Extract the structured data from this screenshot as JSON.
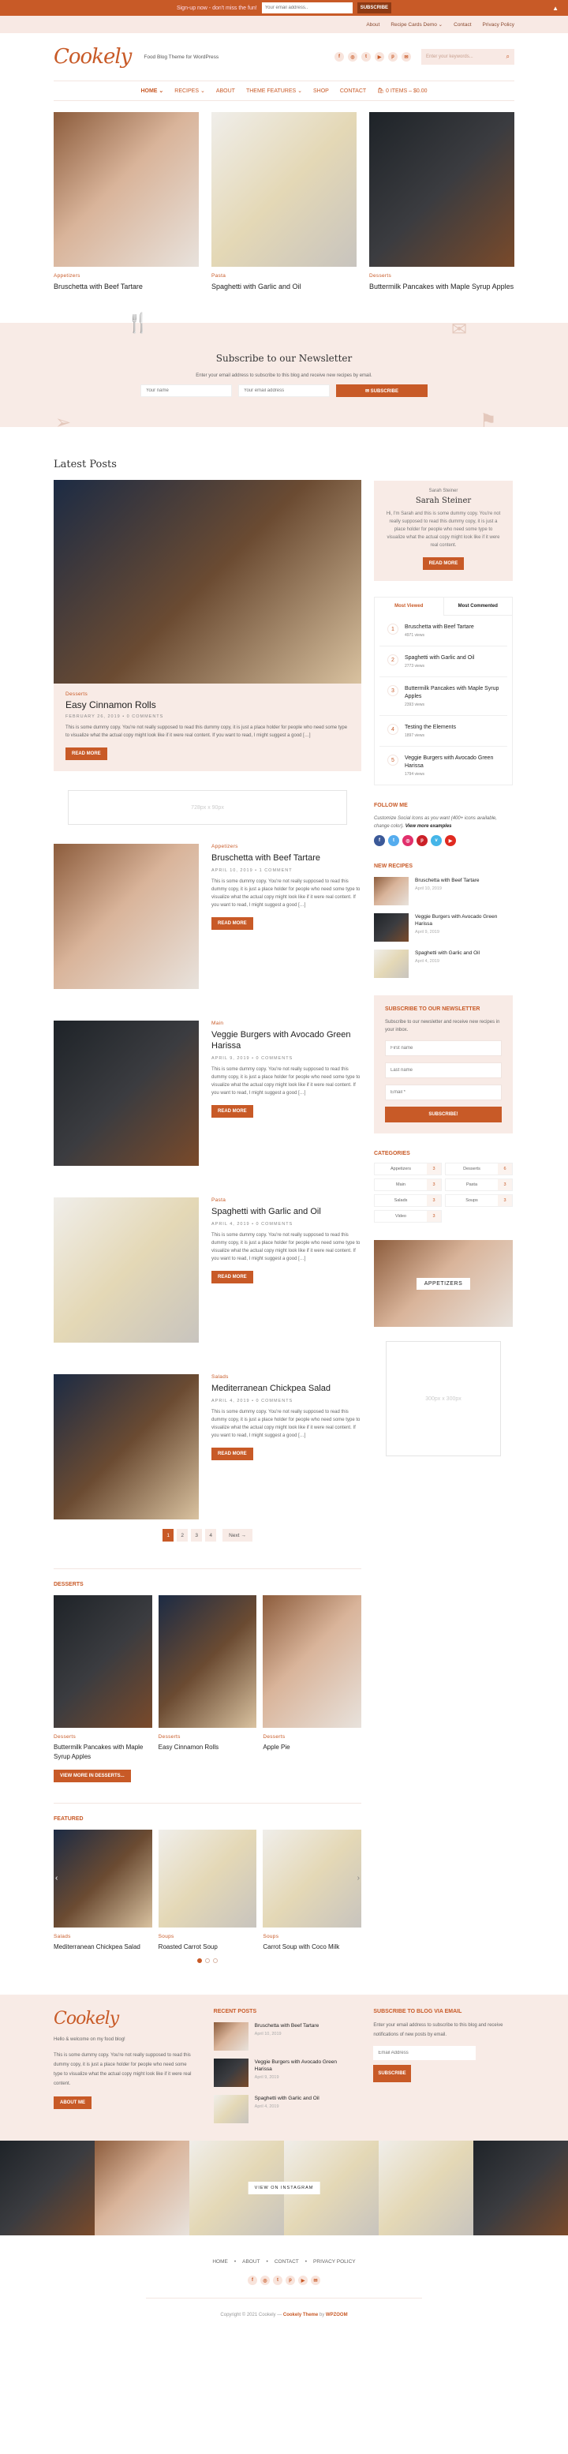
{
  "topbar": {
    "text": "Sign-up now - don't miss the fun!",
    "email_placeholder": "Your email address..",
    "button": "SUBSCRIBE"
  },
  "subnav": [
    "About",
    "Recipe Cards Demo ⌄",
    "Contact",
    "Privacy Policy"
  ],
  "header": {
    "logo": "Cookely",
    "tagline": "Food Blog Theme for WordPress",
    "search_placeholder": "Enter your keywords...",
    "social": [
      "f",
      "◎",
      "t",
      "▶",
      "p",
      "✉"
    ]
  },
  "nav": [
    {
      "label": "Home ⌄",
      "active": true
    },
    {
      "label": "Recipes ⌄"
    },
    {
      "label": "About"
    },
    {
      "label": "Theme Features ⌄"
    },
    {
      "label": "Shop"
    },
    {
      "label": "Contact"
    },
    {
      "label": "🛍 0 items – $0.00"
    }
  ],
  "hero": [
    {
      "category": "Appetizers",
      "title": "Bruschetta with Beef Tartare"
    },
    {
      "category": "Pasta",
      "title": "Spaghetti with Garlic and Oil"
    },
    {
      "category": "Desserts",
      "title": "Buttermilk Pancakes with Maple Syrup Apples"
    }
  ],
  "newsletter": {
    "title": "Subscribe to our Newsletter",
    "text": "Enter your email address to subscribe to this blog and receive new recipes by email.",
    "name_placeholder": "Your name",
    "email_placeholder": "Your email address",
    "button": "✉  SUBSCRIBE"
  },
  "latest": {
    "title": "Latest Posts",
    "featured": {
      "category": "Desserts",
      "title": "Easy Cinnamon Rolls",
      "meta": "February 26, 2019 • 0 Comments",
      "excerpt": "This is some dummy copy. You're not really supposed to read this dummy copy, it is just a place holder for people who need some type to visualize what the actual copy might look like if it were real content. If you want to read, I might suggest a good […]",
      "button": "Read More"
    },
    "ad": "728px x 90px",
    "posts": [
      {
        "category": "Appetizers",
        "title": "Bruschetta with Beef Tartare",
        "meta": "April 10, 2019 • 1 Comment",
        "excerpt": "This is some dummy copy. You're not really supposed to read this dummy copy, it is just a place holder for people who need some type to visualize what the actual copy might look like if it were real content. If you want to read, I might suggest a good […]",
        "button": "Read More"
      },
      {
        "category": "Main",
        "title": "Veggie Burgers with Avocado Green Harissa",
        "meta": "April 9, 2019 • 0 Comments",
        "excerpt": "This is some dummy copy. You're not really supposed to read this dummy copy, it is just a place holder for people who need some type to visualize what the actual copy might look like if it were real content. If you want to read, I might suggest a good […]",
        "button": "Read More"
      },
      {
        "category": "Pasta",
        "title": "Spaghetti with Garlic and Oil",
        "meta": "April 4, 2019 • 0 Comments",
        "excerpt": "This is some dummy copy. You're not really supposed to read this dummy copy, it is just a place holder for people who need some type to visualize what the actual copy might look like if it were real content. If you want to read, I might suggest a good […]",
        "button": "Read More"
      },
      {
        "category": "Salads",
        "title": "Mediterranean Chickpea Salad",
        "meta": "April 4, 2019 • 0 Comments",
        "excerpt": "This is some dummy copy. You're not really supposed to read this dummy copy, it is just a place holder for people who need some type to visualize what the actual copy might look like if it were real content. If you want to read, I might suggest a good […]",
        "button": "Read More"
      }
    ],
    "pager": [
      "1",
      "2",
      "3",
      "4"
    ],
    "pager_next": "Next →"
  },
  "desserts": {
    "title": "Desserts",
    "items": [
      {
        "category": "Desserts",
        "title": "Buttermilk Pancakes with Maple Syrup Apples"
      },
      {
        "category": "Desserts",
        "title": "Easy Cinnamon Rolls"
      },
      {
        "category": "Desserts",
        "title": "Apple Pie"
      }
    ],
    "button": "View more in Desserts..."
  },
  "featured": {
    "title": "Featured",
    "items": [
      {
        "category": "Salads",
        "title": "Mediterranean Chickpea Salad"
      },
      {
        "category": "Soups",
        "title": "Roasted Carrot Soup"
      },
      {
        "category": "Soups",
        "title": "Carrot Soup with Coco Milk"
      }
    ],
    "active_slide": 1,
    "slides": 3
  },
  "sidebar": {
    "about": {
      "small": "Sarah Steiner",
      "name": "Sarah Steiner",
      "text": "Hi, I'm Sarah and this is some dummy copy. You're not really supposed to read this dummy copy, it is just a place holder for people who need some type to visualize what the actual copy might look like if it were real content.",
      "button": "Read More"
    },
    "tabs": [
      "Most Viewed",
      "Most Commented"
    ],
    "popular": [
      {
        "n": "1",
        "title": "Bruschetta with Beef Tartare",
        "views": "4971 views"
      },
      {
        "n": "2",
        "title": "Spaghetti with Garlic and Oil",
        "views": "2773 views"
      },
      {
        "n": "3",
        "title": "Buttermilk Pancakes with Maple Syrup Apples",
        "views": "2393 views"
      },
      {
        "n": "4",
        "title": "Testing the Elements",
        "views": "1897 views"
      },
      {
        "n": "5",
        "title": "Veggie Burgers with Avocado Green Harissa",
        "views": "1794 views"
      }
    ],
    "follow": {
      "title": "Follow Me",
      "text": "Customize Social Icons as you want (400+ icons available, change color).",
      "link": "View more examples",
      "icons": [
        {
          "g": "f",
          "color": "#3b5998"
        },
        {
          "g": "t",
          "color": "#55acee"
        },
        {
          "g": "◎",
          "color": "#e1306c"
        },
        {
          "g": "p",
          "color": "#cb2027"
        },
        {
          "g": "v",
          "color": "#45b5e8"
        },
        {
          "g": "▶",
          "color": "#e02a20"
        }
      ]
    },
    "new_recipes": {
      "title": "New Recipes",
      "items": [
        {
          "title": "Bruschetta with Beef Tartare",
          "date": "April 10, 2019"
        },
        {
          "title": "Veggie Burgers with Avocado Green Harissa",
          "date": "April 9, 2019"
        },
        {
          "title": "Spaghetti with Garlic and Oil",
          "date": "April 4, 2019"
        }
      ]
    },
    "subscribe": {
      "title": "Subscribe to our Newsletter",
      "text": "Subscribe to our newsletter and receive new recipes in your inbox.",
      "first": "First name",
      "last": "Last name",
      "email": "Email *",
      "button": "SUBSCRIBE!"
    },
    "categories": {
      "title": "Categories",
      "items": [
        {
          "name": "Appetizers",
          "count": "3"
        },
        {
          "name": "Desserts",
          "count": "6"
        },
        {
          "name": "Main",
          "count": "3"
        },
        {
          "name": "Pasta",
          "count": "3"
        },
        {
          "name": "Salads",
          "count": "3"
        },
        {
          "name": "Soups",
          "count": "3"
        },
        {
          "name": "Video",
          "count": "3"
        }
      ]
    },
    "cat_image_label": "APPETIZERS",
    "ad": "300px x 300px"
  },
  "footer": {
    "logo": "Cookely",
    "welcome": "Hello & welcome on my food blog!",
    "text": "This is some dummy copy. You're not really supposed to read this dummy copy, it is just a place holder for people who need some type to visualize what the actual copy might look like if it were real content.",
    "about_button": "About Me",
    "recent_title": "Recent Posts",
    "recent": [
      {
        "title": "Bruschetta with Beef Tartare",
        "date": "April 10, 2019"
      },
      {
        "title": "Veggie Burgers with Avocado Green Harissa",
        "date": "April 9, 2019"
      },
      {
        "title": "Spaghetti with Garlic and Oil",
        "date": "April 4, 2019"
      }
    ],
    "subscribe_title": "Subscribe to Blog via Email",
    "subscribe_text": "Enter your email address to subscribe to this blog and receive notifications of new posts by email.",
    "email_placeholder": "Email Address",
    "subscribe_button": "SUBSCRIBE",
    "instagram_label": "VIEW ON INSTAGRAM",
    "nav": [
      "HOME",
      "•",
      "ABOUT",
      "•",
      "CONTACT",
      "•",
      "PRIVACY POLICY"
    ],
    "copyright": "Copyright © 2021 Cookely — ",
    "theme_link": "Cookely Theme",
    "by": " by ",
    "author_link": "WPZOOM"
  }
}
